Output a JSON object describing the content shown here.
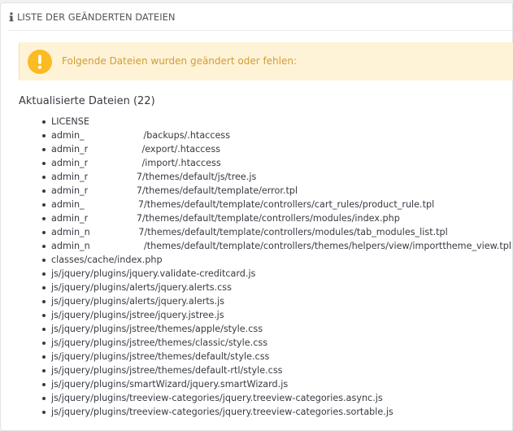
{
  "panel": {
    "heading": "LISTE DER GEÄNDERTEN DATEIEN"
  },
  "alert": {
    "icon": "warning-icon",
    "message": "Folgende Dateien wurden geändert oder fehlen:",
    "color": "#d39b33",
    "background": "#fff3d7"
  },
  "updated": {
    "title": "Aktualisierte Dateien (22)",
    "files": [
      "LICENSE",
      "admin_",
      "/backups/.htaccess",
      "admin_r",
      "/export/.htaccess",
      "admin_r",
      "/import/.htaccess",
      "admin_r",
      "7/themes/default/js/tree.js",
      "admin_r",
      "7/themes/default/template/error.tpl",
      "admin_",
      "7/themes/default/template/controllers/cart_rules/product_rule.tpl",
      "admin_r",
      "7/themes/default/template/controllers/modules/index.php",
      "admin_n",
      "7/themes/default/template/controllers/modules/tab_modules_list.tpl",
      "admin_n",
      "/themes/default/template/controllers/themes/helpers/view/importtheme_view.tpl",
      "classes/cache/index.php",
      "js/jquery/plugins/jquery.validate-creditcard.js",
      "js/jquery/plugins/alerts/jquery.alerts.css",
      "js/jquery/plugins/alerts/jquery.alerts.js",
      "js/jquery/plugins/jstree/jquery.jstree.js",
      "js/jquery/plugins/jstree/themes/apple/style.css",
      "js/jquery/plugins/jstree/themes/classic/style.css",
      "js/jquery/plugins/jstree/themes/default/style.css",
      "js/jquery/plugins/jstree/themes/default-rtl/style.css",
      "js/jquery/plugins/smartWizard/jquery.smartWizard.js",
      "js/jquery/plugins/treeview-categories/jquery.treeview-categories.async.js",
      "js/jquery/plugins/treeview-categories/jquery.treeview-categories.sortable.js"
    ]
  }
}
